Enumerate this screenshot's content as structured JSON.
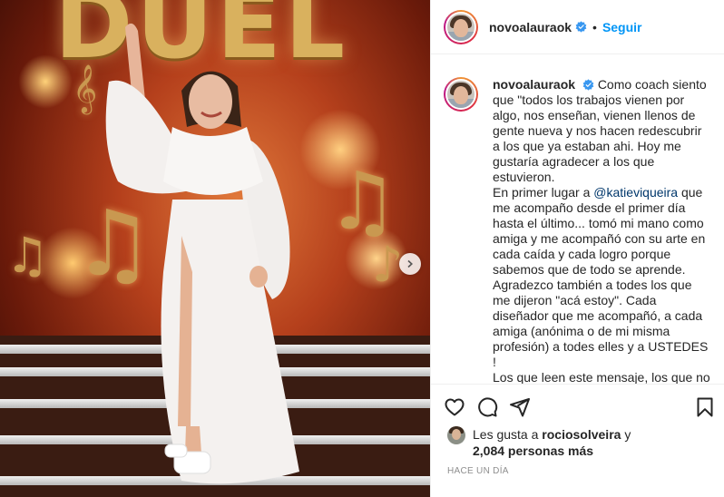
{
  "post": {
    "username": "novoalauraok",
    "follow_label": "Seguir",
    "separator": "•",
    "caption": {
      "intro": "Como coach siento que \"todos los trabajos vienen por algo, nos enseñan, vienen llenos de gente nueva y nos hacen redescubrir a los que ya estaban ahi. Hoy me gustaría agradecer a los que estuvieron.",
      "p2_before": "En primer lugar a ",
      "mention": "@katieviqueira",
      "p2_after": " que me acompaño desde el primer día hasta el último... tomó mi mano como amiga y me acompañó con su arte en cada caída y cada logro porque sabemos que de todo se aprende.",
      "p3": "Agradezco también a todes los que me dijeron \"acá estoy\". Cada diseñador que me acompañó, a cada amiga (anónima o de mi misma profesión) a todes elles y a USTEDES !",
      "p4": "Los que leen este mensaje, los que no"
    },
    "likes": {
      "prefix": "Les gusta a ",
      "user": "rociosolveira",
      "connector": " y",
      "count": "2,084 personas más"
    },
    "time": "HACE UN DÍA"
  },
  "photo": {
    "stage_sign": "DUEL"
  },
  "icons": {
    "verified": "verified-badge-icon",
    "like": "heart-icon",
    "comment": "comment-icon",
    "share": "paper-plane-icon",
    "save": "bookmark-icon",
    "next": "chevron-right-icon"
  },
  "colors": {
    "accent": "#0095f6",
    "text": "#262626",
    "muted": "#8e8e8e",
    "mention": "#00376b"
  }
}
